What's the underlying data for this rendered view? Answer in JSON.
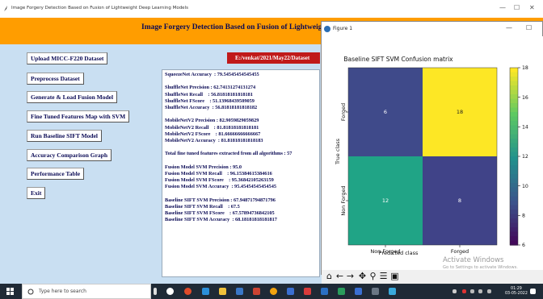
{
  "window": {
    "title": "Image Forgery Detection Based on Fusion of Lightweight Deep Learning Models",
    "minimize": "—",
    "maximize": "☐",
    "close": "✕"
  },
  "banner": {
    "title": "Image Forgery Detection Based on Fusion of Lightweight Deep Learning Models"
  },
  "buttons": [
    {
      "label": "Upload MICC-F220 Dataset"
    },
    {
      "label": "Preprocess Dataset"
    },
    {
      "label": "Generate & Load Fusion Model"
    },
    {
      "label": "Fine Tuned Features Map with SVM"
    },
    {
      "label": "Run Baseline SIFT Model"
    },
    {
      "label": "Accuracy Comparison Graph"
    },
    {
      "label": "Performance Table"
    },
    {
      "label": "Exit"
    }
  ],
  "path_label": "E:/venkat/2021/May22/Dataset",
  "output_text": "SqueezeNet Accuracy  : 79.54545454545455\n\nShuffleNet Precision : 62.74131274131274\nShuffleNet Recall    : 56.81818181818181\nShuffleNet FScore    : 51.13968439509059\nShuffleNet Accuracy  : 56.81818181818182\n\nMobileNetV2 Precision : 82.9059829059829\nMobileNetV2 Recall    : 81.81818181818181\nMobileNetV2 FScore    : 81.66666666666667\nMobileNetV2 Accuracy  : 81.81818181818183\n\nTotal fine tuned features extracted from all algorithms : 57\n\nFusion Model SVM Precision : 95.0\nFusion Model SVM Recall    : 96.15384615384616\nFusion Model SVM FScore    : 95.36842105263159\nFusion Model SVM Accuracy  : 95.45454545454545\n\nBaseline SIFT SVM Precision : 67.94871794871796\nBaseline SIFT SVM Recall    : 67.5\nBaseline SIFT SVM FScore    : 67.57894736842105\nBaseline SIFT SVM Accuracy  : 68.18181818181817",
  "figure": {
    "window_title": "Figure 1",
    "minimize": "—",
    "maximize": "☐",
    "toolbar_icons": [
      "home-icon",
      "back-icon",
      "forward-icon",
      "pan-icon",
      "zoom-icon",
      "configure-icon",
      "save-icon"
    ]
  },
  "chart_data": {
    "type": "heatmap",
    "title": "Baseline SIFT SVM Confusion matrix",
    "xlabel": "Predicted class",
    "ylabel": "True class",
    "x_categories": [
      "Non Forged",
      "Forged"
    ],
    "y_categories": [
      "Forged",
      "Non Forged"
    ],
    "values": [
      [
        6,
        18
      ],
      [
        12,
        8
      ]
    ],
    "colorbar": {
      "min": 6,
      "max": 18,
      "ticks": [
        6,
        8,
        10,
        12,
        14,
        16,
        18
      ]
    },
    "colormap": "viridis",
    "colors": {
      "6": "#3f4a8a",
      "8": "#404388",
      "12": "#20a486",
      "18": "#fde725"
    }
  },
  "watermark": {
    "line1": "Activate Windows",
    "line2": "Go to Settings to activate Windows."
  },
  "taskbar": {
    "search_placeholder": "Type here to search",
    "time": "01:29",
    "date": "03-05-2022"
  }
}
